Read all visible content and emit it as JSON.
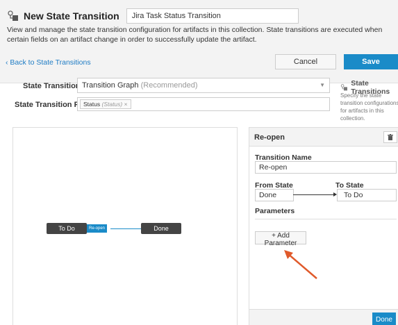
{
  "header": {
    "title": "New State Transition",
    "name_value": "Jira Task Status Transition",
    "description": "View and manage the state transition configuration for artifacts in this collection. State transitions are executed when certain fields on an artifact change in order to successfully update the artifact."
  },
  "toolbar": {
    "back_label": "Back to State Transitions",
    "cancel_label": "Cancel",
    "save_label": "Save"
  },
  "form": {
    "type_label": "State Transition Type",
    "type_value": "Transition Graph",
    "type_hint": "(Recommended)",
    "fields_label": "State Transition Fields",
    "field_tag": "Status",
    "field_tag_sub": "(Status)"
  },
  "help": {
    "title": "State Transitions",
    "text": "Specify the state transition configurations for artifacts in this collection."
  },
  "graph": {
    "from_node": "To Do",
    "edge_label": "Re-open",
    "to_node": "Done"
  },
  "panel": {
    "title": "Re-open",
    "name_label": "Transition Name",
    "name_value": "Re-open",
    "from_label": "From State",
    "from_value": "Done",
    "to_label": "To State",
    "to_value": "To Do",
    "params_label": "Parameters",
    "add_param_label": "+ Add Parameter",
    "done_label": "Done"
  },
  "colors": {
    "accent": "#1a8bc8",
    "node": "#444444",
    "callout_arrow": "#e05a2b"
  }
}
